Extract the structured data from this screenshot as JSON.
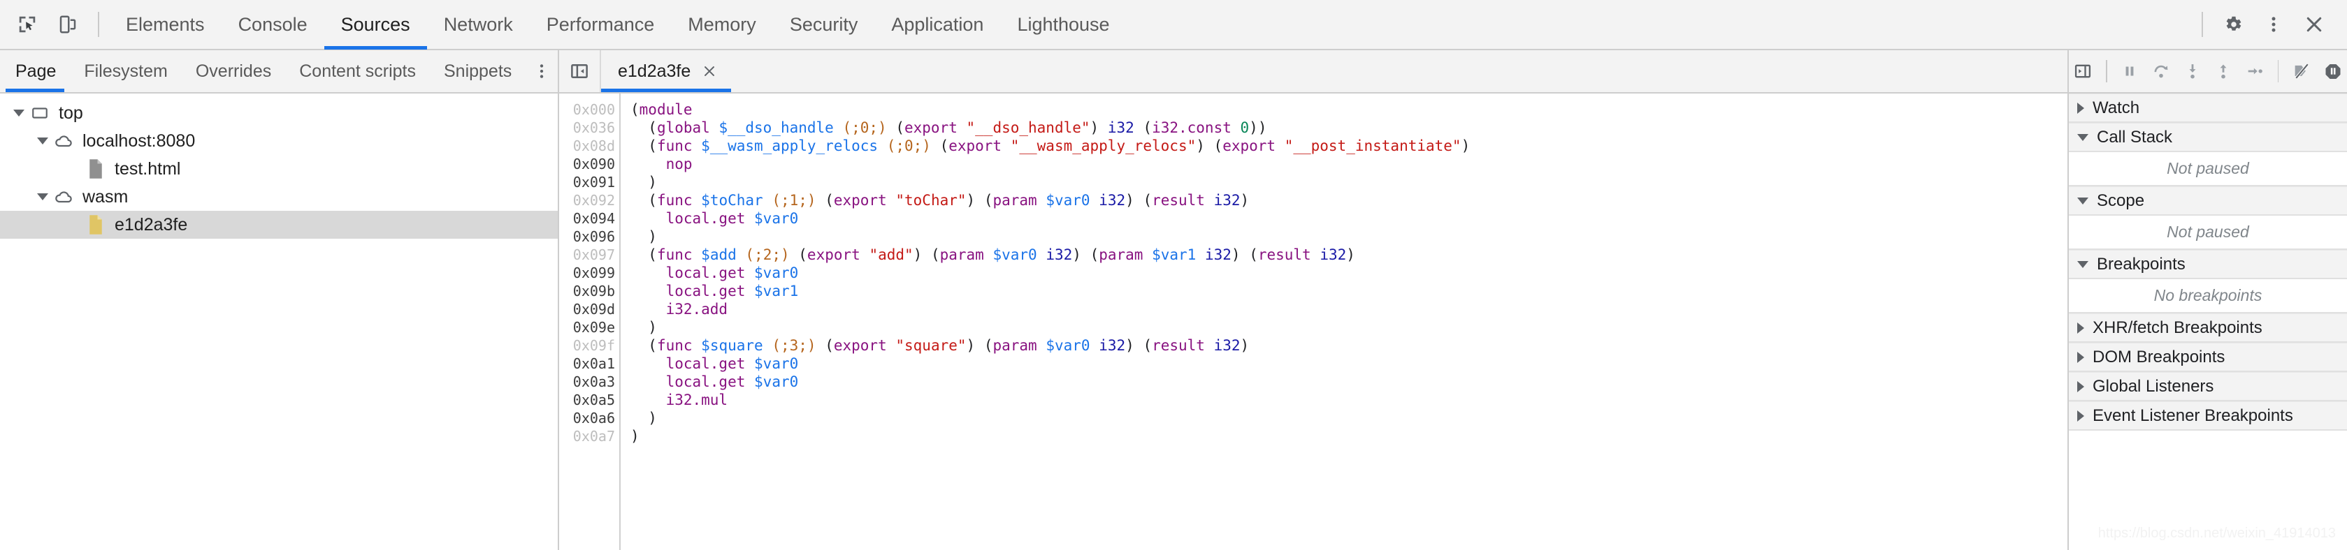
{
  "app": {
    "name": "Chrome DevTools"
  },
  "main_toolbar": {
    "inspect_icon": "inspect-element-icon",
    "device_icon": "device-toolbar-icon",
    "tabs": [
      {
        "label": "Elements",
        "active": false
      },
      {
        "label": "Console",
        "active": false
      },
      {
        "label": "Sources",
        "active": true
      },
      {
        "label": "Network",
        "active": false
      },
      {
        "label": "Performance",
        "active": false
      },
      {
        "label": "Memory",
        "active": false
      },
      {
        "label": "Security",
        "active": false
      },
      {
        "label": "Application",
        "active": false
      },
      {
        "label": "Lighthouse",
        "active": false
      }
    ],
    "right_icons": [
      {
        "name": "gear-icon"
      },
      {
        "name": "more-vertical-icon"
      },
      {
        "name": "close-icon"
      }
    ]
  },
  "navigator": {
    "tabs": [
      {
        "label": "Page",
        "active": true
      },
      {
        "label": "Filesystem",
        "active": false
      },
      {
        "label": "Overrides",
        "active": false
      },
      {
        "label": "Content scripts",
        "active": false
      },
      {
        "label": "Snippets",
        "active": false
      }
    ],
    "more_icon": "more-vertical-icon",
    "tree": [
      {
        "label": "top",
        "depth": 0,
        "icon": "frame-icon",
        "expanded": true,
        "selected": false
      },
      {
        "label": "localhost:8080",
        "depth": 1,
        "icon": "cloud-icon",
        "expanded": true,
        "selected": false
      },
      {
        "label": "test.html",
        "depth": 2,
        "icon": "document-icon",
        "expanded": null,
        "selected": false
      },
      {
        "label": "wasm",
        "depth": 1,
        "icon": "cloud-icon",
        "expanded": true,
        "selected": false
      },
      {
        "label": "e1d2a3fe",
        "depth": 2,
        "icon": "wasm-file-icon",
        "expanded": null,
        "selected": true
      }
    ]
  },
  "editor": {
    "collapse_icon": "collapse-sidebar-icon",
    "tab_label": "e1d2a3fe",
    "close_icon": "close-icon",
    "gutter": [
      {
        "addr": "0x000",
        "dim": true
      },
      {
        "addr": "0x036",
        "dim": true
      },
      {
        "addr": "0x08d",
        "dim": true
      },
      {
        "addr": "0x090",
        "dim": false
      },
      {
        "addr": "0x091",
        "dim": false
      },
      {
        "addr": "0x092",
        "dim": true
      },
      {
        "addr": "0x094",
        "dim": false
      },
      {
        "addr": "0x096",
        "dim": false
      },
      {
        "addr": "0x097",
        "dim": true
      },
      {
        "addr": "0x099",
        "dim": false
      },
      {
        "addr": "0x09b",
        "dim": false
      },
      {
        "addr": "0x09d",
        "dim": false
      },
      {
        "addr": "0x09e",
        "dim": false
      },
      {
        "addr": "0x09f",
        "dim": true
      },
      {
        "addr": "0x0a1",
        "dim": false
      },
      {
        "addr": "0x0a3",
        "dim": false
      },
      {
        "addr": "0x0a5",
        "dim": false
      },
      {
        "addr": "0x0a6",
        "dim": false
      },
      {
        "addr": "0x0a7",
        "dim": true
      }
    ],
    "code_lines": [
      [
        {
          "t": "(",
          "c": "pn"
        },
        {
          "t": "module",
          "c": "k"
        }
      ],
      [
        {
          "t": "  (",
          "c": "pn"
        },
        {
          "t": "global",
          "c": "k"
        },
        {
          "t": " ",
          "c": "pn"
        },
        {
          "t": "$__dso_handle",
          "c": "fn"
        },
        {
          "t": " ",
          "c": "pn"
        },
        {
          "t": "(;0;)",
          "c": "cm"
        },
        {
          "t": " (",
          "c": "pn"
        },
        {
          "t": "export",
          "c": "k"
        },
        {
          "t": " ",
          "c": "pn"
        },
        {
          "t": "\"__dso_handle\"",
          "c": "st"
        },
        {
          "t": ") ",
          "c": "pn"
        },
        {
          "t": "i32",
          "c": "ty"
        },
        {
          "t": " (",
          "c": "pn"
        },
        {
          "t": "i32.const",
          "c": "op"
        },
        {
          "t": " ",
          "c": "pn"
        },
        {
          "t": "0",
          "c": "num"
        },
        {
          "t": "))",
          "c": "pn"
        }
      ],
      [
        {
          "t": "  (",
          "c": "pn"
        },
        {
          "t": "func",
          "c": "k"
        },
        {
          "t": " ",
          "c": "pn"
        },
        {
          "t": "$__wasm_apply_relocs",
          "c": "fn"
        },
        {
          "t": " ",
          "c": "pn"
        },
        {
          "t": "(;0;)",
          "c": "cm"
        },
        {
          "t": " (",
          "c": "pn"
        },
        {
          "t": "export",
          "c": "k"
        },
        {
          "t": " ",
          "c": "pn"
        },
        {
          "t": "\"__wasm_apply_relocs\"",
          "c": "st"
        },
        {
          "t": ") (",
          "c": "pn"
        },
        {
          "t": "export",
          "c": "k"
        },
        {
          "t": " ",
          "c": "pn"
        },
        {
          "t": "\"__post_instantiate\"",
          "c": "st"
        },
        {
          "t": ")",
          "c": "pn"
        }
      ],
      [
        {
          "t": "    ",
          "c": "pn"
        },
        {
          "t": "nop",
          "c": "op"
        }
      ],
      [
        {
          "t": "  )",
          "c": "pn"
        }
      ],
      [
        {
          "t": "  (",
          "c": "pn"
        },
        {
          "t": "func",
          "c": "k"
        },
        {
          "t": " ",
          "c": "pn"
        },
        {
          "t": "$toChar",
          "c": "fn"
        },
        {
          "t": " ",
          "c": "pn"
        },
        {
          "t": "(;1;)",
          "c": "cm"
        },
        {
          "t": " (",
          "c": "pn"
        },
        {
          "t": "export",
          "c": "k"
        },
        {
          "t": " ",
          "c": "pn"
        },
        {
          "t": "\"toChar\"",
          "c": "st"
        },
        {
          "t": ") (",
          "c": "pn"
        },
        {
          "t": "param",
          "c": "k"
        },
        {
          "t": " ",
          "c": "pn"
        },
        {
          "t": "$var0",
          "c": "fn"
        },
        {
          "t": " ",
          "c": "pn"
        },
        {
          "t": "i32",
          "c": "ty"
        },
        {
          "t": ") (",
          "c": "pn"
        },
        {
          "t": "result",
          "c": "k"
        },
        {
          "t": " ",
          "c": "pn"
        },
        {
          "t": "i32",
          "c": "ty"
        },
        {
          "t": ")",
          "c": "pn"
        }
      ],
      [
        {
          "t": "    ",
          "c": "pn"
        },
        {
          "t": "local.get",
          "c": "op"
        },
        {
          "t": " ",
          "c": "pn"
        },
        {
          "t": "$var0",
          "c": "fn"
        }
      ],
      [
        {
          "t": "  )",
          "c": "pn"
        }
      ],
      [
        {
          "t": "  (",
          "c": "pn"
        },
        {
          "t": "func",
          "c": "k"
        },
        {
          "t": " ",
          "c": "pn"
        },
        {
          "t": "$add",
          "c": "fn"
        },
        {
          "t": " ",
          "c": "pn"
        },
        {
          "t": "(;2;)",
          "c": "cm"
        },
        {
          "t": " (",
          "c": "pn"
        },
        {
          "t": "export",
          "c": "k"
        },
        {
          "t": " ",
          "c": "pn"
        },
        {
          "t": "\"add\"",
          "c": "st"
        },
        {
          "t": ") (",
          "c": "pn"
        },
        {
          "t": "param",
          "c": "k"
        },
        {
          "t": " ",
          "c": "pn"
        },
        {
          "t": "$var0",
          "c": "fn"
        },
        {
          "t": " ",
          "c": "pn"
        },
        {
          "t": "i32",
          "c": "ty"
        },
        {
          "t": ") (",
          "c": "pn"
        },
        {
          "t": "param",
          "c": "k"
        },
        {
          "t": " ",
          "c": "pn"
        },
        {
          "t": "$var1",
          "c": "fn"
        },
        {
          "t": " ",
          "c": "pn"
        },
        {
          "t": "i32",
          "c": "ty"
        },
        {
          "t": ") (",
          "c": "pn"
        },
        {
          "t": "result",
          "c": "k"
        },
        {
          "t": " ",
          "c": "pn"
        },
        {
          "t": "i32",
          "c": "ty"
        },
        {
          "t": ")",
          "c": "pn"
        }
      ],
      [
        {
          "t": "    ",
          "c": "pn"
        },
        {
          "t": "local.get",
          "c": "op"
        },
        {
          "t": " ",
          "c": "pn"
        },
        {
          "t": "$var0",
          "c": "fn"
        }
      ],
      [
        {
          "t": "    ",
          "c": "pn"
        },
        {
          "t": "local.get",
          "c": "op"
        },
        {
          "t": " ",
          "c": "pn"
        },
        {
          "t": "$var1",
          "c": "fn"
        }
      ],
      [
        {
          "t": "    ",
          "c": "pn"
        },
        {
          "t": "i32.add",
          "c": "op"
        }
      ],
      [
        {
          "t": "  )",
          "c": "pn"
        }
      ],
      [
        {
          "t": "  (",
          "c": "pn"
        },
        {
          "t": "func",
          "c": "k"
        },
        {
          "t": " ",
          "c": "pn"
        },
        {
          "t": "$square",
          "c": "fn"
        },
        {
          "t": " ",
          "c": "pn"
        },
        {
          "t": "(;3;)",
          "c": "cm"
        },
        {
          "t": " (",
          "c": "pn"
        },
        {
          "t": "export",
          "c": "k"
        },
        {
          "t": " ",
          "c": "pn"
        },
        {
          "t": "\"square\"",
          "c": "st"
        },
        {
          "t": ") (",
          "c": "pn"
        },
        {
          "t": "param",
          "c": "k"
        },
        {
          "t": " ",
          "c": "pn"
        },
        {
          "t": "$var0",
          "c": "fn"
        },
        {
          "t": " ",
          "c": "pn"
        },
        {
          "t": "i32",
          "c": "ty"
        },
        {
          "t": ") (",
          "c": "pn"
        },
        {
          "t": "result",
          "c": "k"
        },
        {
          "t": " ",
          "c": "pn"
        },
        {
          "t": "i32",
          "c": "ty"
        },
        {
          "t": ")",
          "c": "pn"
        }
      ],
      [
        {
          "t": "    ",
          "c": "pn"
        },
        {
          "t": "local.get",
          "c": "op"
        },
        {
          "t": " ",
          "c": "pn"
        },
        {
          "t": "$var0",
          "c": "fn"
        }
      ],
      [
        {
          "t": "    ",
          "c": "pn"
        },
        {
          "t": "local.get",
          "c": "op"
        },
        {
          "t": " ",
          "c": "pn"
        },
        {
          "t": "$var0",
          "c": "fn"
        }
      ],
      [
        {
          "t": "    ",
          "c": "pn"
        },
        {
          "t": "i32.mul",
          "c": "op"
        }
      ],
      [
        {
          "t": "  )",
          "c": "pn"
        }
      ],
      [
        {
          "t": ")",
          "c": "pn"
        }
      ]
    ]
  },
  "debugger": {
    "buttons": [
      {
        "name": "show-debugger-sidebar-icon"
      },
      {
        "name": "pause-script-icon"
      },
      {
        "name": "step-over-icon"
      },
      {
        "name": "step-into-icon"
      },
      {
        "name": "step-out-icon"
      },
      {
        "name": "step-icon"
      },
      {
        "name": "deactivate-breakpoints-icon"
      },
      {
        "name": "pause-on-exceptions-icon"
      }
    ],
    "sections": [
      {
        "title": "Watch",
        "expanded": false,
        "empty_text": null
      },
      {
        "title": "Call Stack",
        "expanded": true,
        "empty_text": "Not paused"
      },
      {
        "title": "Scope",
        "expanded": true,
        "empty_text": "Not paused"
      },
      {
        "title": "Breakpoints",
        "expanded": true,
        "empty_text": "No breakpoints"
      },
      {
        "title": "XHR/fetch Breakpoints",
        "expanded": false,
        "empty_text": null
      },
      {
        "title": "DOM Breakpoints",
        "expanded": false,
        "empty_text": null
      },
      {
        "title": "Global Listeners",
        "expanded": false,
        "empty_text": null
      },
      {
        "title": "Event Listener Breakpoints",
        "expanded": false,
        "empty_text": null
      }
    ]
  },
  "watermark": {
    "text": "https://blog.csdn.net/weixin_41914013"
  },
  "colors": {
    "accent": "#1a73e8",
    "toolbar_bg": "#f3f3f3",
    "selected_row": "#d8d8d8",
    "wasm_file": "#e0c565"
  }
}
